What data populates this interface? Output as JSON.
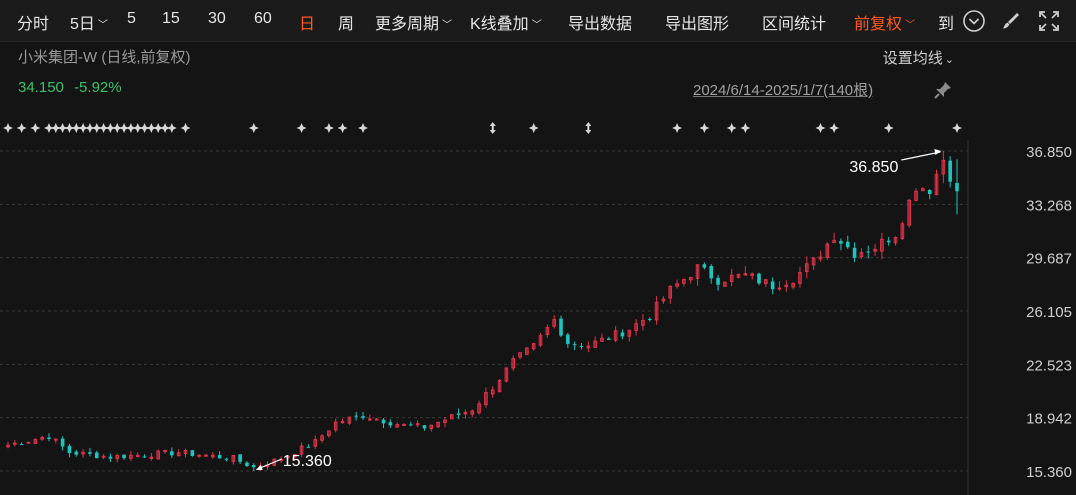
{
  "toolbar": {
    "items": [
      {
        "label": "分时",
        "dropdown": false,
        "active": false
      },
      {
        "label": "5日",
        "dropdown": true,
        "active": false
      },
      {
        "label": "5",
        "dropdown": false,
        "active": false
      },
      {
        "label": "15",
        "dropdown": false,
        "active": false
      },
      {
        "label": "30",
        "dropdown": false,
        "active": false
      },
      {
        "label": "60",
        "dropdown": false,
        "active": false
      },
      {
        "label": "日",
        "dropdown": false,
        "active": true
      },
      {
        "label": "周",
        "dropdown": false,
        "active": false
      },
      {
        "label": "更多周期",
        "dropdown": true,
        "active": false
      },
      {
        "label": "K线叠加",
        "dropdown": true,
        "active": false
      },
      {
        "label": "导出数据",
        "dropdown": false,
        "active": false
      },
      {
        "label": "导出图形",
        "dropdown": false,
        "active": false
      },
      {
        "label": "区间统计",
        "dropdown": false,
        "active": false
      },
      {
        "label": "前复权",
        "dropdown": true,
        "active": true
      },
      {
        "label": "到",
        "dropdown": false,
        "active": false
      }
    ],
    "icons": [
      "chevron-down-circle-icon",
      "brush-icon",
      "fullscreen-icon"
    ]
  },
  "stock": {
    "name": "小米集团-W (日线,前复权)",
    "price": "34.150",
    "change": "-5.92%",
    "date_range": "2024/6/14-2025/1/7(140根)",
    "settings_label": "设置均线"
  },
  "colors": {
    "up": "#e2334a",
    "down": "#20c4be",
    "grid": "#3a3a3a",
    "event_marker": "#d7d7d7",
    "active": "#ff5a1f",
    "price_down": "#3ec06a"
  },
  "chart_data": {
    "type": "candlestick",
    "bars": 140,
    "ylim": [
      15.36,
      36.85
    ],
    "y_ticks": [
      "36.850",
      "33.268",
      "29.687",
      "26.105",
      "22.523",
      "18.942",
      "15.360"
    ],
    "y_ticks_values": [
      36.85,
      33.268,
      29.687,
      26.105,
      22.523,
      18.942,
      15.36
    ],
    "annotations": [
      {
        "label": "36.850",
        "type": "max",
        "bar": 137
      },
      {
        "label": "15.360",
        "type": "min",
        "bar": 36
      }
    ],
    "close_trend": [
      [
        0,
        17.1
      ],
      [
        6,
        17.7
      ],
      [
        9,
        16.6
      ],
      [
        15,
        16.3
      ],
      [
        25,
        16.6
      ],
      [
        33,
        16.2
      ],
      [
        36,
        15.6
      ],
      [
        40,
        16.2
      ],
      [
        45,
        17.3
      ],
      [
        48,
        18.6
      ],
      [
        52,
        19.1
      ],
      [
        58,
        18.4
      ],
      [
        61,
        18.3
      ],
      [
        64,
        18.8
      ],
      [
        68,
        19.5
      ],
      [
        71,
        21.0
      ],
      [
        74,
        22.7
      ],
      [
        77,
        23.7
      ],
      [
        80,
        25.5
      ],
      [
        82,
        24.0
      ],
      [
        85,
        23.8
      ],
      [
        88,
        24.3
      ],
      [
        91,
        24.9
      ],
      [
        94,
        25.8
      ],
      [
        97,
        27.5
      ],
      [
        101,
        29.0
      ],
      [
        104,
        28.2
      ],
      [
        108,
        28.5
      ],
      [
        112,
        27.8
      ],
      [
        115,
        28.3
      ],
      [
        118,
        29.4
      ],
      [
        121,
        31.2
      ],
      [
        124,
        30.0
      ],
      [
        127,
        30.4
      ],
      [
        130,
        31.3
      ],
      [
        133,
        34.5
      ],
      [
        135,
        34.3
      ],
      [
        137,
        36.3
      ],
      [
        139,
        34.15
      ]
    ],
    "event_marker_bars": [
      0,
      2,
      4,
      6,
      7,
      8,
      9,
      10,
      11,
      12,
      13,
      14,
      15,
      16,
      17,
      18,
      19,
      20,
      21,
      22,
      23,
      24,
      26,
      36,
      43,
      47,
      49,
      52,
      71,
      77,
      85,
      98,
      102,
      106,
      108,
      119,
      121,
      129,
      139
    ]
  }
}
